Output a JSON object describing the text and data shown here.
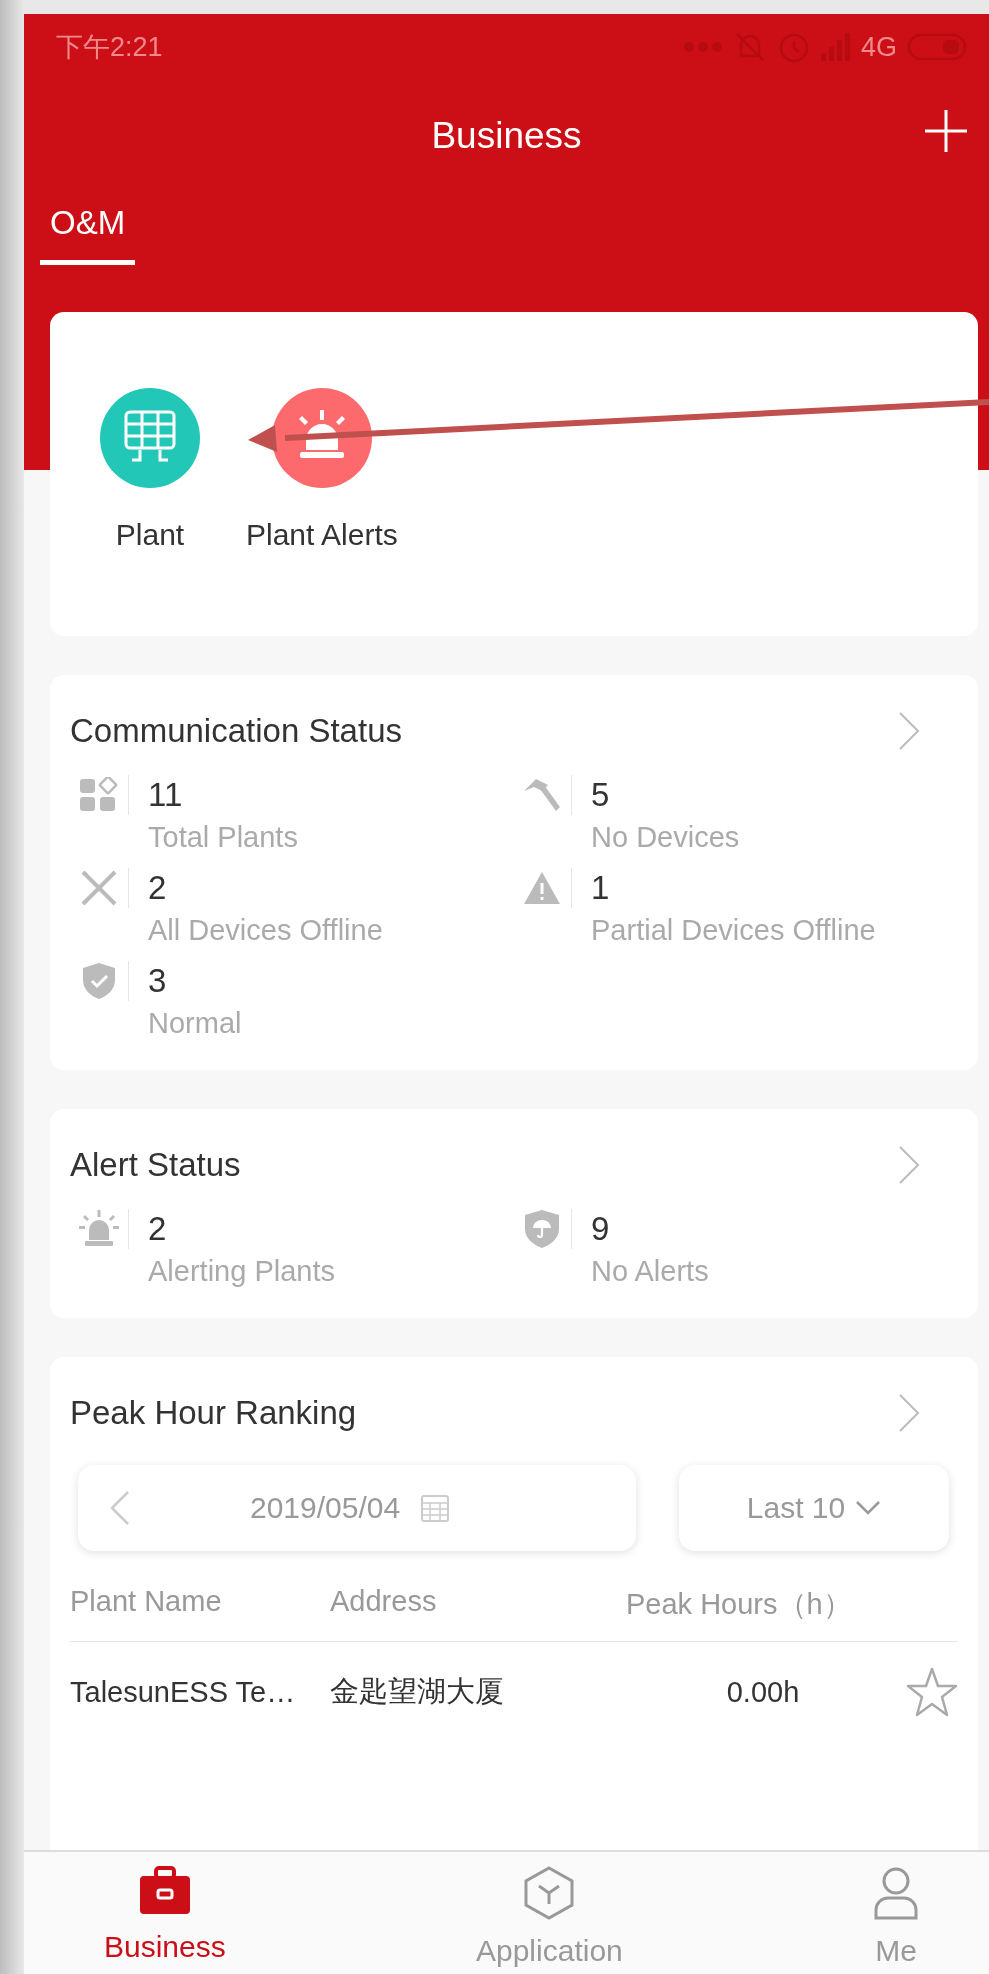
{
  "status_bar": {
    "time": "下午2:21",
    "network": "4G"
  },
  "header": {
    "title": "Business"
  },
  "tabs": [
    {
      "label": "O&M",
      "selected": true
    }
  ],
  "shortcuts": [
    {
      "label": "Plant",
      "kind": "solar"
    },
    {
      "label": "Plant Alerts",
      "kind": "alarm"
    }
  ],
  "communication_status": {
    "title": "Communication Status",
    "stats": [
      {
        "kind": "grid",
        "value": "11",
        "label": "Total Plants"
      },
      {
        "kind": "hammer",
        "value": "5",
        "label": "No Devices"
      },
      {
        "kind": "cross",
        "value": "2",
        "label": "All Devices Offline"
      },
      {
        "kind": "warning",
        "value": "1",
        "label": "Partial Devices Offline"
      },
      {
        "kind": "shield",
        "value": "3",
        "label": "Normal"
      }
    ]
  },
  "alert_status": {
    "title": "Alert Status",
    "stats": [
      {
        "kind": "alarm",
        "value": "2",
        "label": "Alerting Plants"
      },
      {
        "kind": "umbrella",
        "value": "9",
        "label": "No Alerts"
      }
    ]
  },
  "peak_hour_ranking": {
    "title": "Peak Hour Ranking",
    "date": "2019/05/04",
    "filter": "Last 10",
    "columns": [
      "Plant Name",
      "Address",
      "Peak Hours（h）"
    ],
    "rows": [
      {
        "plant_name": "TalesunESS Te…",
        "address": "金匙望湖大厦",
        "peak_hours": "0.00h",
        "starred": false
      }
    ]
  },
  "bottom_nav": [
    {
      "label": "Business",
      "kind": "briefcase",
      "selected": true
    },
    {
      "label": "Application",
      "kind": "cube",
      "selected": false
    },
    {
      "label": "Me",
      "kind": "person",
      "selected": false
    }
  ]
}
